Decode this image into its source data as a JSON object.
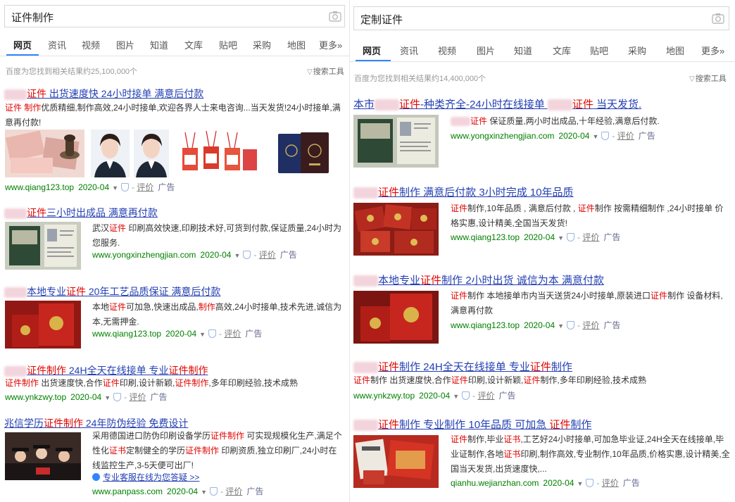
{
  "left": {
    "query": "证件制作",
    "tabs": [
      "网页",
      "资讯",
      "视频",
      "图片",
      "知道",
      "文库",
      "贴吧",
      "采购",
      "地图",
      "更多»"
    ],
    "result_count": "百度为您找到相关结果约25,100,000个",
    "search_tools": "搜索工具",
    "results": [
      {
        "title_parts": [
          [
            "",
            "blur"
          ],
          [
            "证件",
            "red"
          ],
          [
            " 出货速度快 24小时接单 满意后付款",
            ""
          ]
        ],
        "desc_parts": [
          [
            "证件 制作",
            "red"
          ],
          [
            "优质精细,制作高效,24小时接单,欢迎各界人士来电咨询...当天发货!24小时接单,满意再付款!",
            ""
          ]
        ],
        "url": "www.qiang123.top",
        "date": "2020-04",
        "review": "评价",
        "ad": "广告"
      },
      {
        "title_parts": [
          [
            "",
            "blur"
          ],
          [
            "证件",
            "red"
          ],
          [
            "三小时出成品 满意再付款",
            ""
          ]
        ],
        "desc_parts": [
          [
            "武汉",
            ""
          ],
          [
            "证件",
            "red"
          ],
          [
            " 印刷高效快速,印刷技术好,可货到付款,保证质量,24小时为您服务.",
            ""
          ]
        ],
        "url": "www.yongxinzhengjian.com",
        "date": "2020-04",
        "review": "评价",
        "ad": "广告"
      },
      {
        "title_parts": [
          [
            "",
            "blur"
          ],
          [
            "本地专业",
            ""
          ],
          [
            "证件",
            "red"
          ],
          [
            " 20年工艺品质保证 满意后付款",
            ""
          ]
        ],
        "desc_parts": [
          [
            "本地",
            ""
          ],
          [
            "证件",
            "red"
          ],
          [
            "可加急,快速出成品,",
            ""
          ],
          [
            "制作",
            "red"
          ],
          [
            "高效,24小时接单,技术先进,诚信为本,无需押金.",
            ""
          ]
        ],
        "url": "www.qiang123.top",
        "date": "2020-04",
        "review": "评价",
        "ad": "广告"
      },
      {
        "title_parts": [
          [
            "",
            "blur"
          ],
          [
            "证件制作",
            "red"
          ],
          [
            " 24H全天在线接单 专业",
            ""
          ],
          [
            "证件制作",
            "red"
          ]
        ],
        "desc_parts": [
          [
            "证件制作",
            "red"
          ],
          [
            " 出货速度快,合作",
            ""
          ],
          [
            "证件",
            "red"
          ],
          [
            "印刷,设计新颖,",
            ""
          ],
          [
            "证件制作",
            "red"
          ],
          [
            ",多年印刷经验,技术成熟",
            ""
          ]
        ],
        "url": "www.ynkzwy.top",
        "date": "2020-04",
        "review": "评价",
        "ad": "广告"
      },
      {
        "title_parts": [
          [
            "兆信学历",
            ""
          ],
          [
            "证件制作",
            "red"
          ],
          [
            " 24年防伪经验 免费设计",
            ""
          ]
        ],
        "desc_parts": [
          [
            "采用德国进口防伪印刷设备学历",
            ""
          ],
          [
            "证件制作",
            "red"
          ],
          [
            " 可实现规模化生产,满足个性化",
            ""
          ],
          [
            "证书",
            "red"
          ],
          [
            "定制健全的学历",
            ""
          ],
          [
            "证件制作",
            "red"
          ],
          [
            " 印刷资质,独立印刷厂,24小时在线监控生产,3-5天便可出厂!",
            ""
          ]
        ],
        "extra_link": "专业客服在线为您答疑 >>",
        "url": "www.panpass.com",
        "date": "2020-04",
        "review": "评价",
        "ad": "广告"
      }
    ]
  },
  "right": {
    "query": "定制证件",
    "tabs": [
      "网页",
      "资讯",
      "视频",
      "图片",
      "知道",
      "文库",
      "贴吧",
      "采购",
      "地图",
      "更多»"
    ],
    "result_count": "百度为您找到相关结果约14,400,000个",
    "search_tools": "搜索工具",
    "results": [
      {
        "title_parts": [
          [
            "本市",
            ""
          ],
          [
            "",
            "blur"
          ],
          [
            "证件",
            "red"
          ],
          [
            "-种类齐全-24小时在线接单 ",
            ""
          ],
          [
            "",
            "blur"
          ],
          [
            "证件",
            "red"
          ],
          [
            " 当天发货.",
            ""
          ]
        ],
        "desc_parts": [
          [
            "",
            "blur"
          ],
          [
            "证件",
            "red"
          ],
          [
            " 保证质量,两小时出成品,十年经验,满意后付款.",
            ""
          ]
        ],
        "url": "www.yongxinzhengjian.com",
        "date": "2020-04",
        "review": "评价",
        "ad": "广告"
      },
      {
        "title_parts": [
          [
            "",
            "blur"
          ],
          [
            "证件",
            "red"
          ],
          [
            "制作 满意后付款 3小时完成 10年品质",
            ""
          ]
        ],
        "desc_parts": [
          [
            "证件",
            "red"
          ],
          [
            "制作,10年品质 , 满意后付款 , ",
            ""
          ],
          [
            "证件",
            "red"
          ],
          [
            "制作 按需精细制作 ,24小时接单 价格实惠,设计精美,全国当天发货!",
            ""
          ]
        ],
        "url": "www.qiang123.top",
        "date": "2020-04",
        "review": "评价",
        "ad": "广告"
      },
      {
        "title_parts": [
          [
            "",
            "blur"
          ],
          [
            "本地专业",
            ""
          ],
          [
            "证件",
            "red"
          ],
          [
            "制作 2小时出货 诚信为本 满意付款",
            ""
          ]
        ],
        "desc_parts": [
          [
            "证件",
            "red"
          ],
          [
            "制作 本地接单市内当天送货24小时接单,原装进口",
            ""
          ],
          [
            "证件",
            "red"
          ],
          [
            "制作 设备材料,满意再付款",
            ""
          ]
        ],
        "url": "www.qiang123.top",
        "date": "2020-04",
        "review": "评价",
        "ad": "广告"
      },
      {
        "title_parts": [
          [
            "",
            "blur"
          ],
          [
            "证件",
            "red"
          ],
          [
            "制作 24H全天在线接单 专业",
            ""
          ],
          [
            "证件",
            "red"
          ],
          [
            "制作",
            ""
          ]
        ],
        "desc_parts": [
          [
            "证件",
            "red"
          ],
          [
            "制作 出货速度快,合作",
            ""
          ],
          [
            "证件",
            "red"
          ],
          [
            "印刷,设计新颖,",
            ""
          ],
          [
            "证件",
            "red"
          ],
          [
            "制作,多年印刷经验,技术成熟",
            ""
          ]
        ],
        "url": "www.ynkzwy.top",
        "date": "2020-04",
        "review": "评价",
        "ad": "广告"
      },
      {
        "title_parts": [
          [
            "",
            "blur"
          ],
          [
            "证件",
            "red"
          ],
          [
            "制作 专业制作 10年品质 可加急 ",
            ""
          ],
          [
            "证件",
            "red"
          ],
          [
            "制作",
            ""
          ]
        ],
        "desc_parts": [
          [
            "证件",
            "red"
          ],
          [
            "制作,毕业",
            ""
          ],
          [
            "证书",
            "red"
          ],
          [
            ",工艺好24小时接单,可加急毕业证,24H全天在线接单,毕业证制作,各地",
            ""
          ],
          [
            "证书",
            "red"
          ],
          [
            "印刷,制作高效,专业制作,10年品质,价格实惠,设计精美,全国当天发货,出货速度快,...",
            ""
          ]
        ],
        "url": "qianhu.wejianzhan.com",
        "date": "2020-04",
        "review": "评价",
        "ad": "广告"
      }
    ]
  }
}
